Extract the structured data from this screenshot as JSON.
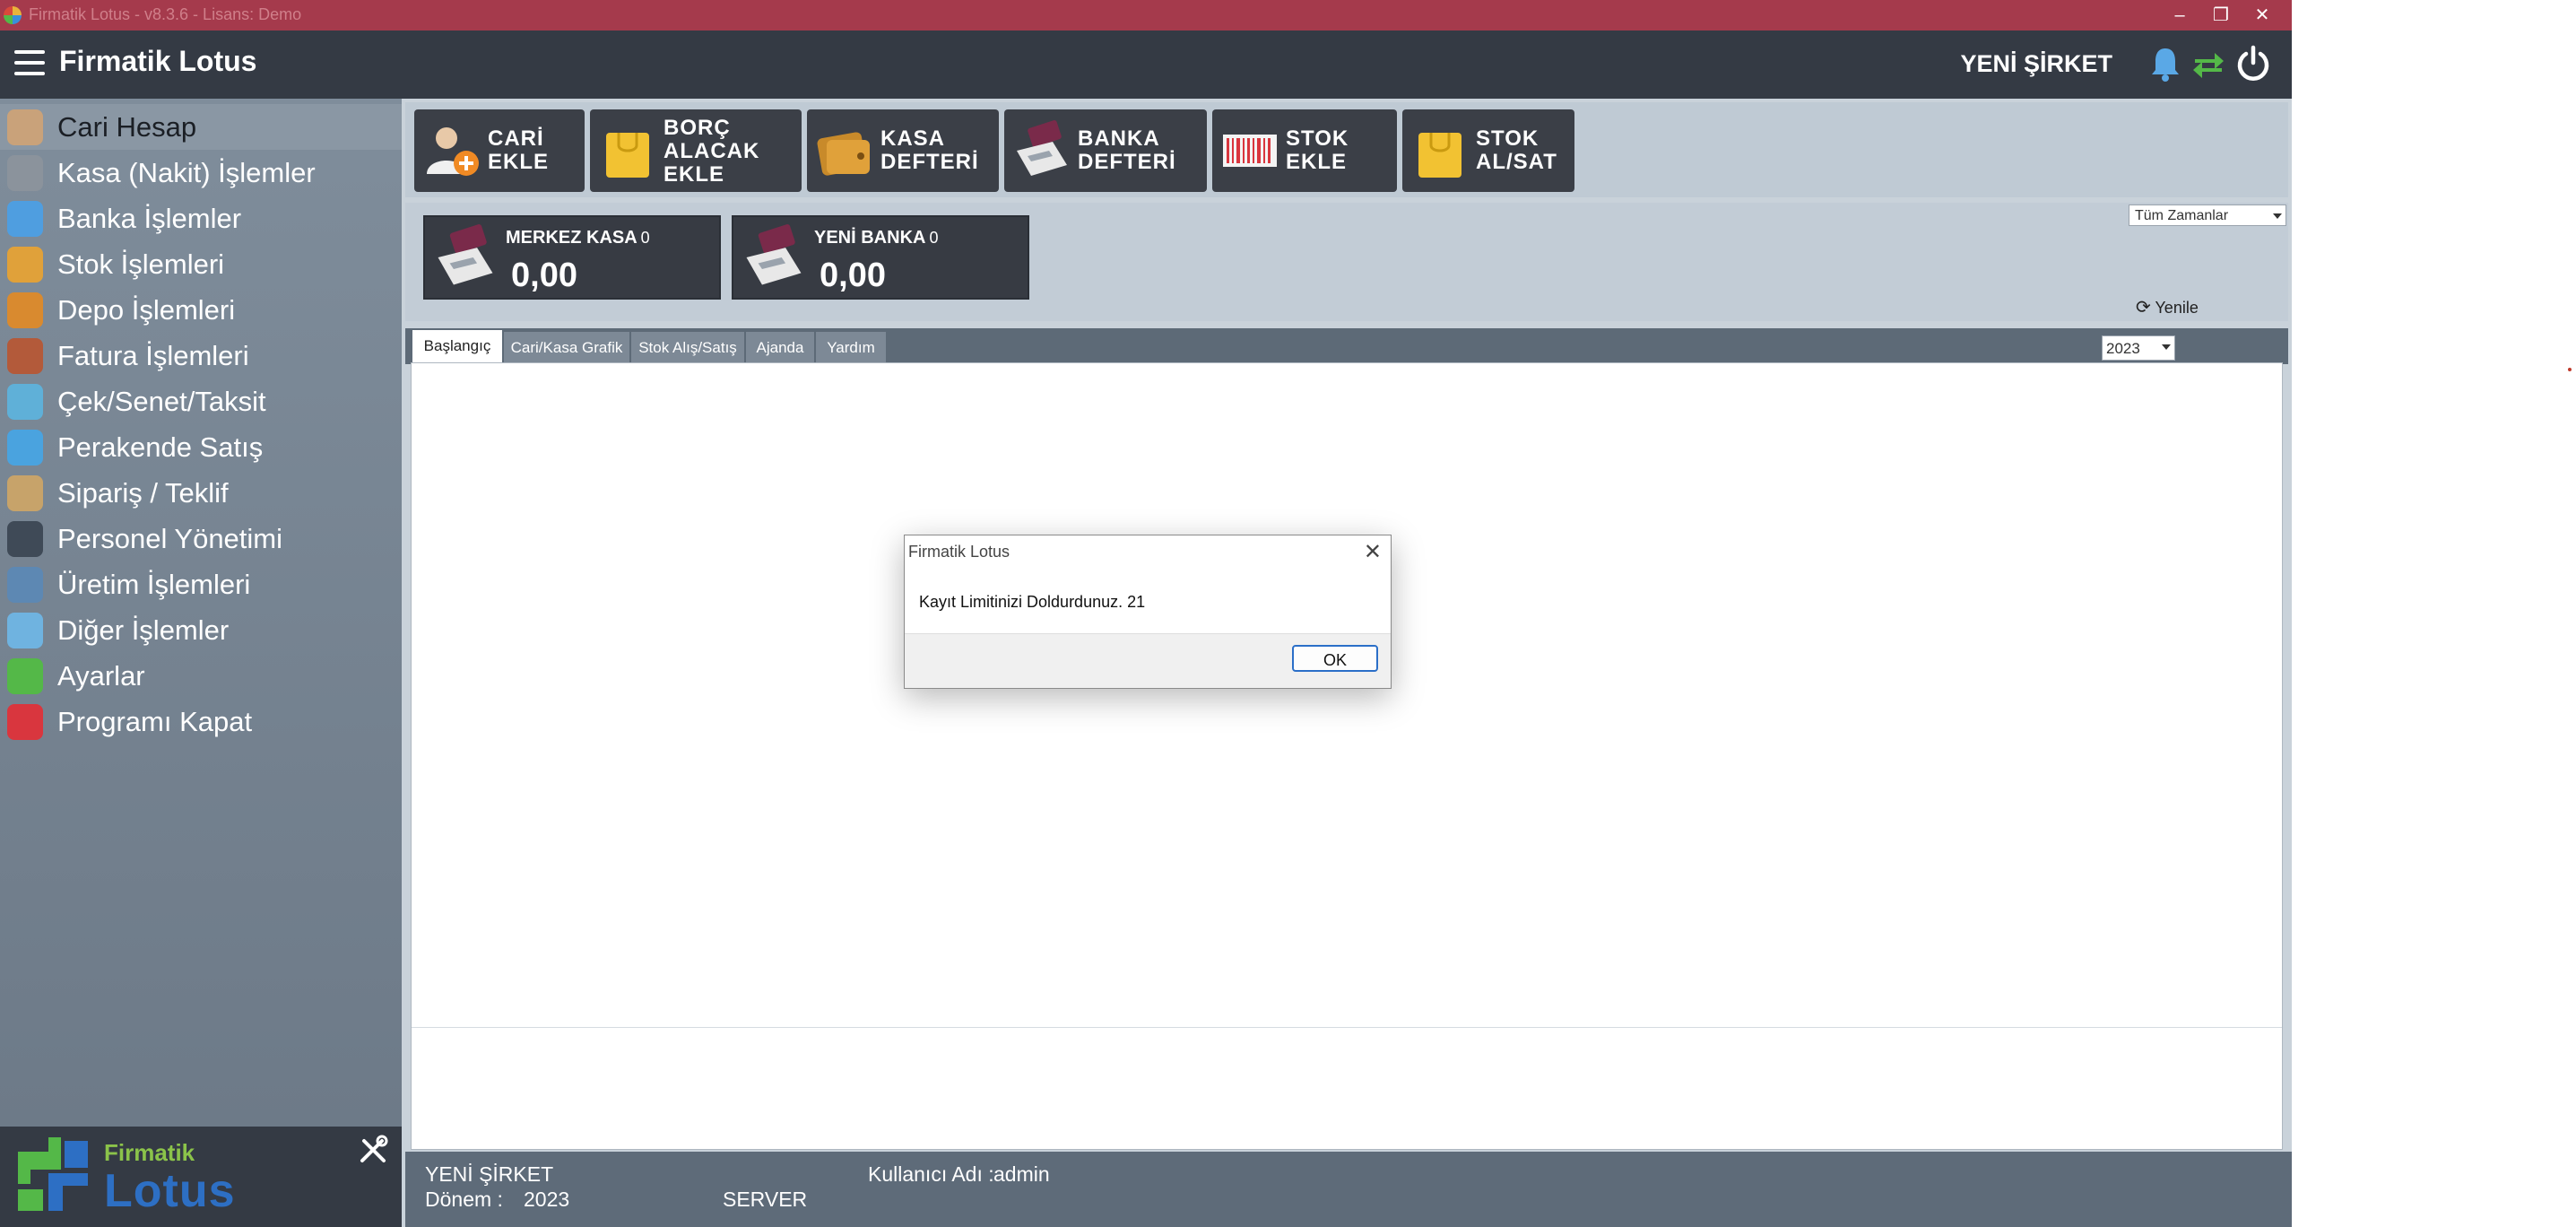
{
  "window": {
    "title": "Firmatik Lotus - v8.3.6 - Lisans: Demo",
    "accent_color": "#a53a4c"
  },
  "header": {
    "brand": "Firmatik Lotus",
    "company": "YENİ ŞİRKET",
    "icons": [
      "bell-icon",
      "sync-icon",
      "power-icon"
    ]
  },
  "sidebar": {
    "items": [
      {
        "label": "Cari Hesap",
        "icon": "people-icon",
        "active": true
      },
      {
        "label": "Kasa (Nakit) İşlemler",
        "icon": "lira-icon"
      },
      {
        "label": "Banka İşlemler",
        "icon": "bank-icon"
      },
      {
        "label": "Stok İşlemleri",
        "icon": "box-icon"
      },
      {
        "label": "Depo İşlemleri",
        "icon": "warehouse-icon"
      },
      {
        "label": "Fatura İşlemleri",
        "icon": "invoice-icon"
      },
      {
        "label": "Çek/Senet/Taksit",
        "icon": "check-icon"
      },
      {
        "label": "Perakende Satış",
        "icon": "store-icon"
      },
      {
        "label": "Sipariş / Teklif",
        "icon": "clipboard-icon"
      },
      {
        "label": "Personel Yönetimi",
        "icon": "person-icon"
      },
      {
        "label": "Üretim İşlemleri",
        "icon": "worker-icon"
      },
      {
        "label": "Diğer İşlemler",
        "icon": "window-icon"
      },
      {
        "label": "Ayarlar",
        "icon": "tools-icon"
      },
      {
        "label": "Programı Kapat",
        "icon": "power-icon"
      }
    ],
    "logo": {
      "line1": "Firmatik",
      "line2": "Lotus"
    }
  },
  "shortcuts": [
    {
      "lines": [
        "CARİ",
        "EKLE"
      ],
      "icon": "add-contact-icon"
    },
    {
      "lines": [
        "BORÇ",
        "ALACAK",
        "EKLE"
      ],
      "icon": "bag-icon"
    },
    {
      "lines": [
        "KASA",
        "DEFTERİ"
      ],
      "icon": "wallet-icon"
    },
    {
      "lines": [
        "BANKA",
        "DEFTERİ"
      ],
      "icon": "pos-terminal-icon"
    },
    {
      "lines": [
        "STOK",
        "EKLE"
      ],
      "icon": "barcode-icon"
    },
    {
      "lines": [
        "STOK",
        "AL/SAT"
      ],
      "icon": "bag-icon"
    }
  ],
  "accounts": [
    {
      "name": "MERKEZ KASA",
      "badge": "0",
      "value": "0,00"
    },
    {
      "name": "YENİ BANKA",
      "badge": "0",
      "value": "0,00"
    }
  ],
  "filters": {
    "time_range": "Tüm Zamanlar",
    "refresh_label": "Yenile",
    "year": "2023"
  },
  "tabs": [
    {
      "label": "Başlangıç",
      "active": true
    },
    {
      "label": "Cari/Kasa Grafik"
    },
    {
      "label": "Stok Alış/Satış"
    },
    {
      "label": "Ajanda"
    },
    {
      "label": "Yardım"
    }
  ],
  "status": {
    "company": "YENİ ŞİRKET",
    "period_label": "Dönem :",
    "period_value": "2023",
    "server": "SERVER",
    "user_label": "Kullanıcı Adı :",
    "user_value": "admin"
  },
  "dialog": {
    "title": "Firmatik Lotus",
    "message": "Kayıt Limitinizi Doldurdunuz. 21",
    "ok_label": "OK"
  }
}
